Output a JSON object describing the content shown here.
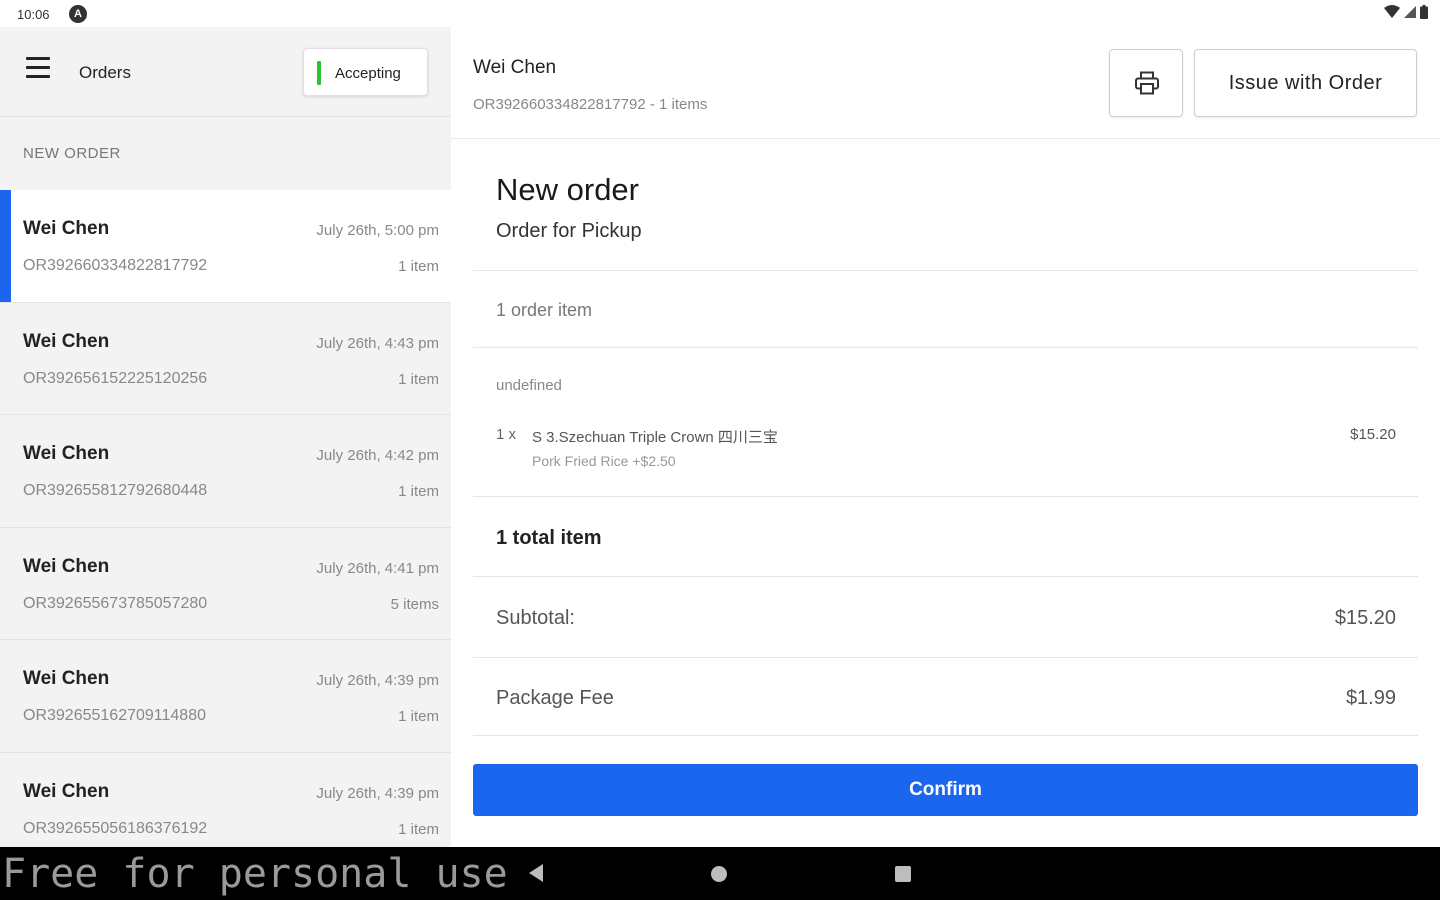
{
  "status_bar": {
    "time": "10:06",
    "notification_glyph": "A"
  },
  "left": {
    "title": "Orders",
    "accepting_label": "Accepting",
    "accepting_color": "#2ec22e",
    "section_label": "NEW ORDER",
    "orders": [
      {
        "name": "Wei Chen",
        "id": "OR392660334822817792",
        "time": "July 26th, 5:00 pm",
        "count": "1 item"
      },
      {
        "name": "Wei Chen",
        "id": "OR392656152225120256",
        "time": "July 26th, 4:43 pm",
        "count": "1 item"
      },
      {
        "name": "Wei Chen",
        "id": "OR392655812792680448",
        "time": "July 26th, 4:42 pm",
        "count": "1 item"
      },
      {
        "name": "Wei Chen",
        "id": "OR392655673785057280",
        "time": "July 26th, 4:41 pm",
        "count": "5 items"
      },
      {
        "name": "Wei Chen",
        "id": "OR392655162709114880",
        "time": "July 26th, 4:39 pm",
        "count": "1 item"
      },
      {
        "name": "Wei Chen",
        "id": "OR392655056186376192",
        "time": "July 26th, 4:39 pm",
        "count": "1 item"
      }
    ]
  },
  "right": {
    "header_name": "Wei Chen",
    "header_sub": "OR392660334822817792 - 1 items",
    "print_icon": "printer-icon",
    "issue_label": "Issue with Order",
    "title": "New order",
    "subtitle": "Order for Pickup",
    "item_count": "1 order item",
    "category": "undefined",
    "line_item": {
      "qty": "1 x",
      "name": "S 3.Szechuan Triple Crown 四川三宝",
      "price": "$15.20",
      "modifier": "Pork Fried Rice +$2.50"
    },
    "total_items": "1 total item",
    "subtotal_label": "Subtotal:",
    "subtotal_value": "$15.20",
    "fee_label": "Package Fee",
    "fee_value": "$1.99",
    "confirm_label": "Confirm",
    "accent": "#1a66ef"
  },
  "nav": {
    "watermark": "Free for personal use"
  }
}
